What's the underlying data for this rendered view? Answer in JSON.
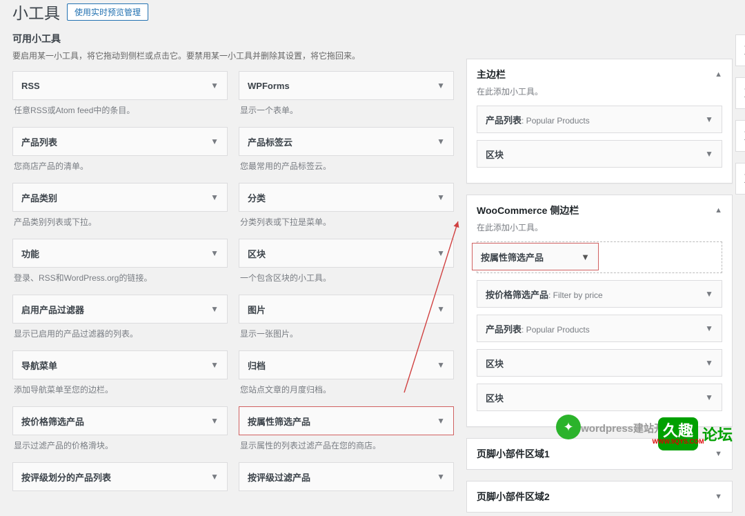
{
  "header": {
    "title": "小工具",
    "preview_btn": "使用实时预览管理"
  },
  "available": {
    "title": "可用小工具",
    "desc": "要启用某一小工具，将它拖动到侧栏或点击它。要禁用某一小工具并删除其设置，将它拖回来。",
    "left": [
      {
        "name": "RSS",
        "desc": "任意RSS或Atom feed中的条目。"
      },
      {
        "name": "产品列表",
        "desc": "您商店产品的清单。"
      },
      {
        "name": "产品类别",
        "desc": "产品类别列表或下拉。"
      },
      {
        "name": "功能",
        "desc": "登录、RSS和WordPress.org的链接。"
      },
      {
        "name": "启用产品过滤器",
        "desc": "显示已启用的产品过滤器的列表。"
      },
      {
        "name": "导航菜单",
        "desc": "添加导航菜单至您的边栏。"
      },
      {
        "name": "按价格筛选产品",
        "desc": "显示过滤产品的价格滑块。"
      },
      {
        "name": "按评级划分的产品列表",
        "desc": ""
      }
    ],
    "right": [
      {
        "name": "WPForms",
        "desc": "显示一个表单。"
      },
      {
        "name": "产品标签云",
        "desc": "您最常用的产品标签云。"
      },
      {
        "name": "分类",
        "desc": "分类列表或下拉是菜单。"
      },
      {
        "name": "区块",
        "desc": "一个包含区块的小工具。"
      },
      {
        "name": "图片",
        "desc": "显示一张图片。"
      },
      {
        "name": "归档",
        "desc": "您站点文章的月度归档。"
      },
      {
        "name": "按属性筛选产品",
        "desc": "显示属性的列表过滤产品在您的商店。",
        "hl": true
      },
      {
        "name": "按评级过滤产品",
        "desc": ""
      }
    ]
  },
  "areas": {
    "main_sidebar": {
      "title": "主边栏",
      "desc": "在此添加小工具。",
      "items": [
        {
          "label": "产品列表",
          "sub": ": Popular Products"
        },
        {
          "label": "区块",
          "sub": ""
        }
      ]
    },
    "woo_sidebar": {
      "title": "WooCommerce 侧边栏",
      "desc": "在此添加小工具。",
      "drop_label": "按属性筛选产品",
      "items": [
        {
          "label": "按价格筛选产品",
          "sub": ": Filter by price"
        },
        {
          "label": "产品列表",
          "sub": ": Popular Products"
        },
        {
          "label": "区块",
          "sub": ""
        },
        {
          "label": "区块",
          "sub": ""
        }
      ]
    },
    "footer1": "页脚小部件区域1",
    "footer2": "页脚小部件区域2"
  },
  "far_right": [
    "页",
    "页",
    "页",
    "页"
  ],
  "watermark": {
    "logo_top": "久趣",
    "url": "WWW.9QYS.COM",
    "txt1": "论坛",
    "wx_label": "wordpress建站开发"
  }
}
